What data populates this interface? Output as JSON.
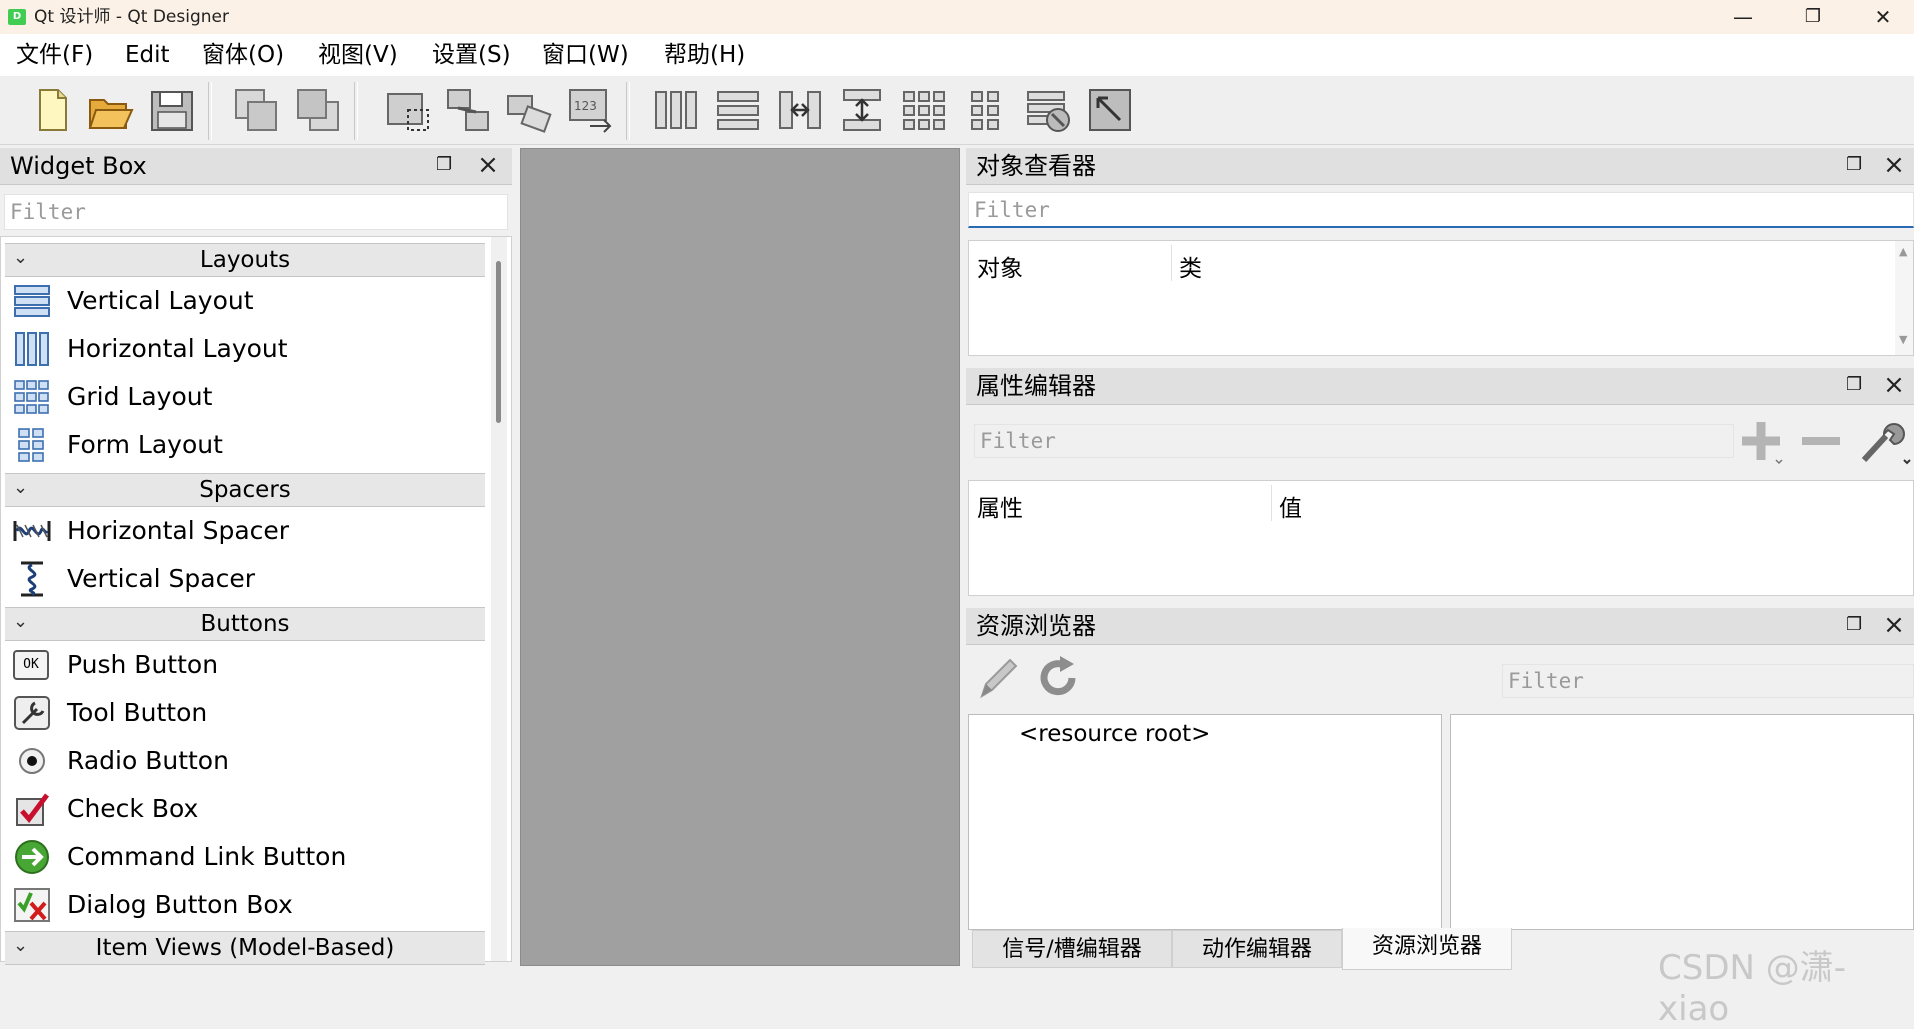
{
  "window": {
    "title": "Qt 设计师 - Qt Designer",
    "app_icon_text": "D",
    "minimize": "—",
    "maximize": "❐",
    "close": "✕"
  },
  "menubar": [
    "文件(F)",
    "Edit",
    "窗体(O)",
    "视图(V)",
    "设置(S)",
    "窗口(W)",
    "帮助(H)"
  ],
  "widget_box": {
    "title": "Widget Box",
    "filter_placeholder": "Filter",
    "categories": [
      {
        "name": "Layouts",
        "items": [
          "Vertical Layout",
          "Horizontal Layout",
          "Grid Layout",
          "Form Layout"
        ]
      },
      {
        "name": "Spacers",
        "items": [
          "Horizontal Spacer",
          "Vertical Spacer"
        ]
      },
      {
        "name": "Buttons",
        "items": [
          "Push Button",
          "Tool Button",
          "Radio Button",
          "Check Box",
          "Command Link Button",
          "Dialog Button Box"
        ]
      },
      {
        "name": "Item Views (Model-Based)",
        "items": []
      }
    ],
    "push_button_icon_text": "OK"
  },
  "object_inspector": {
    "title": "对象查看器",
    "filter_placeholder": "Filter",
    "columns": [
      "对象",
      "类"
    ]
  },
  "property_editor": {
    "title": "属性编辑器",
    "filter_placeholder": "Filter",
    "columns": [
      "属性",
      "值"
    ]
  },
  "resource_browser": {
    "title": "资源浏览器",
    "filter_placeholder": "Filter",
    "root_item": "<resource root>",
    "tabs": [
      "信号/槽编辑器",
      "动作编辑器",
      "资源浏览器"
    ]
  },
  "watermark": "CSDN @潇-xiao",
  "colors": {
    "titlebar_bg": "#fbf1e6",
    "canvas_bg": "#a0a0a0",
    "accent": "#2a6ab3"
  }
}
